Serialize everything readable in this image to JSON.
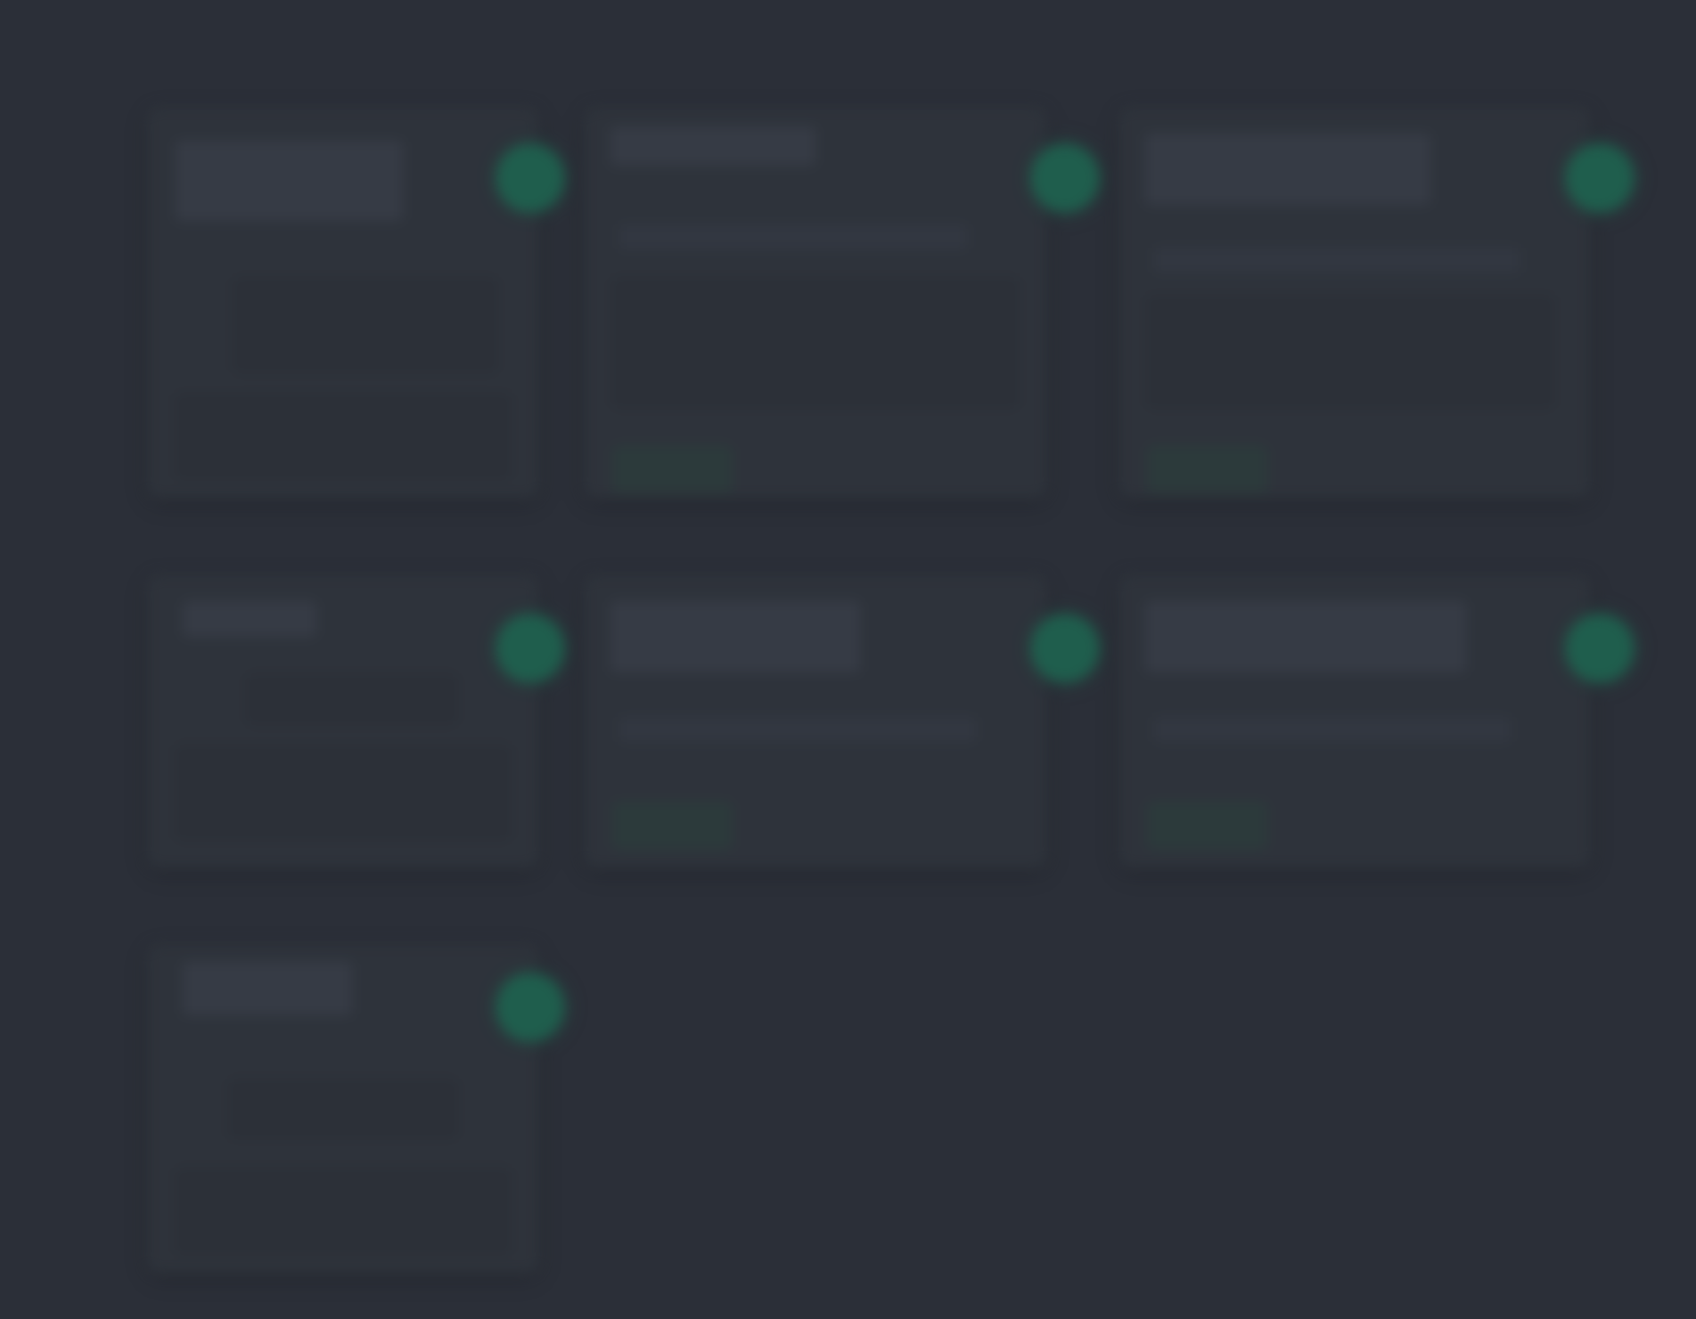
{
  "page": {
    "background": "#2b2f38",
    "accent": "#1f5e4d"
  },
  "cards": [
    {
      "title": "",
      "subtitle": "",
      "status": "status-dot-icon"
    },
    {
      "title": "",
      "subtitle": "",
      "body": "",
      "action": "",
      "status": "status-dot-icon"
    },
    {
      "title": "",
      "subtitle": "",
      "body": "",
      "action": "",
      "status": "status-dot-icon"
    },
    {
      "title": "",
      "subtitle": "",
      "status": "status-dot-icon"
    },
    {
      "title": "",
      "subtitle": "",
      "body": "",
      "action": "",
      "status": "status-dot-icon"
    },
    {
      "title": "",
      "subtitle": "",
      "body": "",
      "action": "",
      "status": "status-dot-icon"
    },
    {
      "title": "",
      "subtitle": "",
      "status": "status-dot-icon"
    }
  ]
}
